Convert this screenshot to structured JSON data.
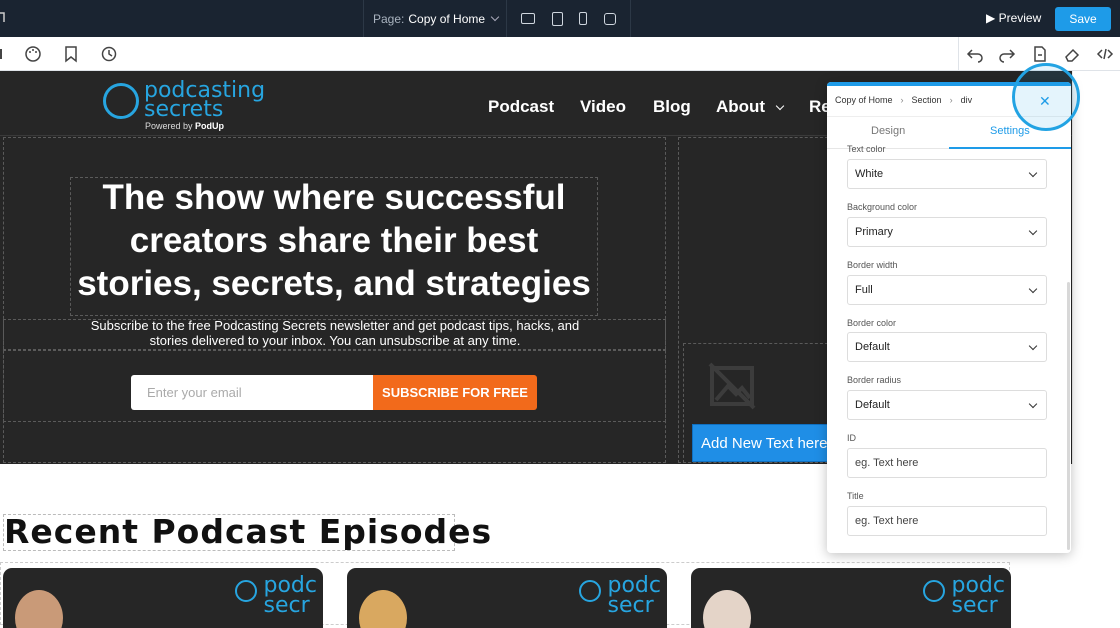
{
  "topbar": {
    "page_label": "Page:",
    "page_name": "Copy of Home",
    "preview_label": "Preview",
    "save_label": "Save"
  },
  "site": {
    "logo_line1": "podcasting",
    "logo_line2": "secrets",
    "powered_prefix": "Powered by",
    "powered_brand": "PodUp",
    "nav": [
      "Podcast",
      "Video",
      "Blog",
      "About",
      "Re"
    ],
    "headline": "The show where successful creators share their best stories, secrets, and strategies",
    "subtext": "Subscribe to the free Podcasting Secrets newsletter and get podcast tips, hacks, and stories delivered to your inbox. You can unsubscribe at any time.",
    "email_placeholder": "Enter your email",
    "subscribe_label": "SUBSCRIBE FOR FREE",
    "add_text_label": "Add New Text here",
    "recent_heading": "Recent Podcast Episodes",
    "card_logo_line1": "podc",
    "card_logo_line2": "secr"
  },
  "panel": {
    "breadcrumb": [
      "Copy of Home",
      "Section",
      "div"
    ],
    "tabs": [
      "Design",
      "Settings"
    ],
    "active_tab": "Settings",
    "fields": {
      "text_color_label": "Text color",
      "text_color_value": "White",
      "bg_color_label": "Background color",
      "bg_color_value": "Primary",
      "border_width_label": "Border width",
      "border_width_value": "Full",
      "border_color_label": "Border color",
      "border_color_value": "Default",
      "border_radius_label": "Border radius",
      "border_radius_value": "Default",
      "id_label": "ID",
      "id_placeholder": "eg. Text here",
      "title_label": "Title",
      "title_placeholder": "eg. Text here"
    }
  },
  "colors": {
    "accent": "#1e9be8",
    "brand_blue": "#27a5e0",
    "orange": "#f26a1b",
    "dark_bg": "#262626",
    "topbar": "#1a2431"
  }
}
